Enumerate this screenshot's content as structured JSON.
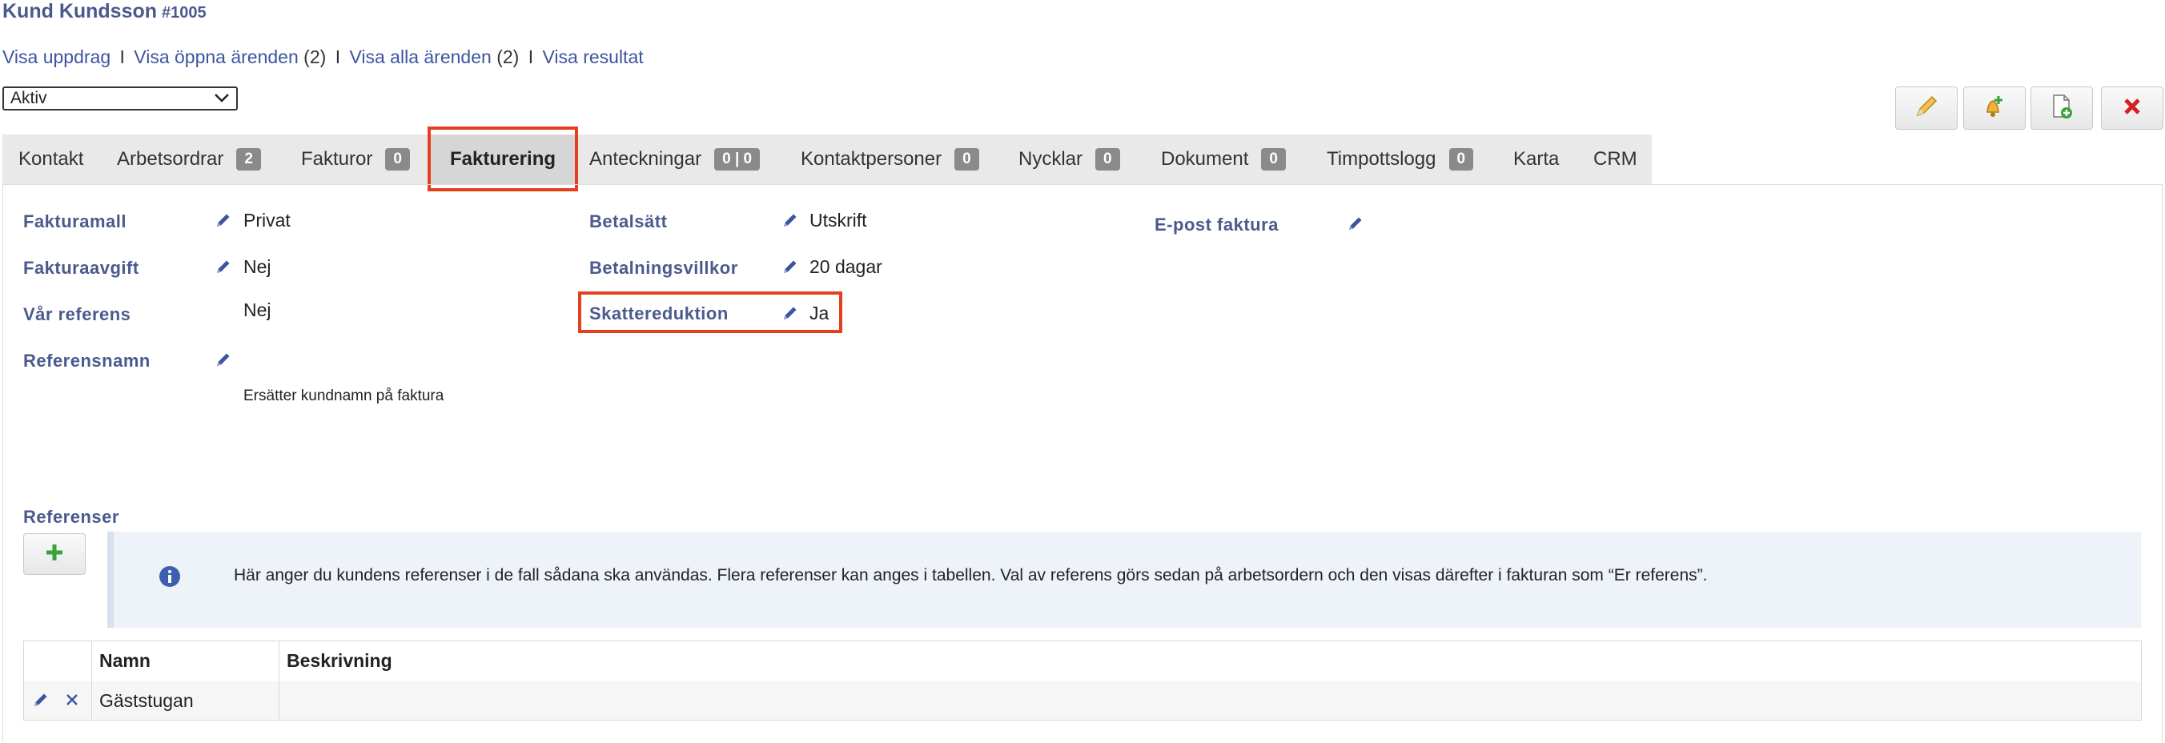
{
  "header": {
    "title": "Kund Kundsson",
    "customer_id": "#1005"
  },
  "links": {
    "visa_uppdrag": "Visa uppdrag",
    "sep": "I",
    "visa_oppna": "Visa öppna ärenden",
    "oppna_count": "(2)",
    "visa_alla": "Visa alla ärenden",
    "alla_count": "(2)",
    "visa_resultat": "Visa resultat"
  },
  "status_select": {
    "value": "Aktiv"
  },
  "tabs": [
    {
      "label": "Kontakt"
    },
    {
      "label": "Arbetsordrar",
      "badge": "2"
    },
    {
      "label": "Fakturor",
      "badge": "0"
    },
    {
      "label": "Fakturering",
      "active": true
    },
    {
      "label": "Anteckningar",
      "badge": "0 | 0"
    },
    {
      "label": "Kontaktpersoner",
      "badge": "0"
    },
    {
      "label": "Nycklar",
      "badge": "0"
    },
    {
      "label": "Dokument",
      "badge": "0"
    },
    {
      "label": "Timpottslogg",
      "badge": "0"
    },
    {
      "label": "Karta"
    },
    {
      "label": "CRM"
    }
  ],
  "fields": {
    "fakturamall": {
      "label": "Fakturamall",
      "value": "Privat"
    },
    "fakturaavgift": {
      "label": "Fakturaavgift",
      "value": "Nej"
    },
    "var_referens": {
      "label": "Vår referens",
      "value": "Nej"
    },
    "referensnamn": {
      "label": "Referensnamn",
      "hint": "Ersätter kundnamn på faktura"
    },
    "betalsatt": {
      "label": "Betalsätt",
      "value": "Utskrift"
    },
    "betalningsvillkor": {
      "label": "Betalningsvillkor",
      "value": "20 dagar"
    },
    "skattereduktion": {
      "label": "Skattereduktion",
      "value": "Ja"
    },
    "epost_faktura": {
      "label": "E-post faktura"
    }
  },
  "references": {
    "heading": "Referenser",
    "info": "Här anger du kundens referenser i de fall sådana ska användas. Flera referenser kan anges i tabellen. Val av referens görs sedan på arbetsordern och den visas därefter i fakturan som “Er referens”.",
    "columns": {
      "name": "Namn",
      "description": "Beskrivning"
    },
    "rows": [
      {
        "name": "Gäststugan",
        "description": ""
      }
    ]
  },
  "colors": {
    "label_blue": "#4a5a8c",
    "link_blue": "#3d54a0",
    "highlight_red": "#e4401f"
  }
}
